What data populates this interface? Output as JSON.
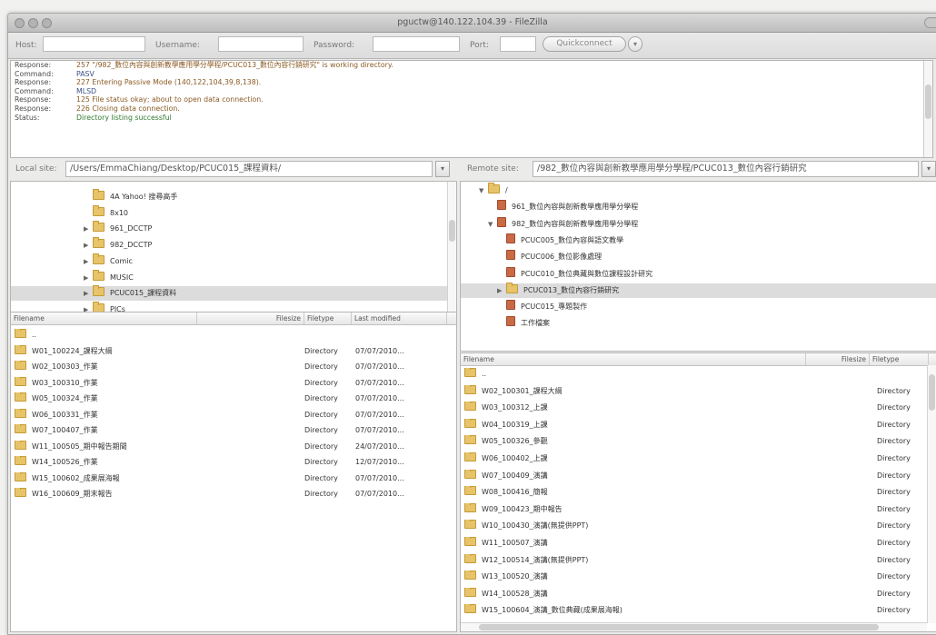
{
  "window": {
    "title": "pguctw@140.122.104.39 - FileZilla",
    "colors": {
      "folder": "#e7c469",
      "folder_special": "#c86b45",
      "selection": "#dcdcdc"
    }
  },
  "quickconnect": {
    "host_label": "Host:",
    "username_label": "Username:",
    "password_label": "Password:",
    "port_label": "Port:",
    "host_value": "",
    "username_value": "",
    "password_value": "",
    "port_value": "",
    "button_label": "Quickconnect",
    "dropdown_icon": "chevron-down-icon"
  },
  "log": [
    {
      "key": "Response:",
      "val": "257 \"/982_數位內容與創新教學應用學分學程/PCUC013_數位內容行銷研究\" is working directory.",
      "tone": "brown"
    },
    {
      "key": "Command:",
      "val": "PASV",
      "tone": "blue"
    },
    {
      "key": "Response:",
      "val": "227 Entering Passive Mode (140,122,104,39,8,138).",
      "tone": "brown"
    },
    {
      "key": "Command:",
      "val": "MLSD",
      "tone": "blue"
    },
    {
      "key": "Response:",
      "val": "125 File status okay; about to open data connection.",
      "tone": "brown"
    },
    {
      "key": "Response:",
      "val": "226 Closing data connection.",
      "tone": "brown"
    },
    {
      "key": "Status:",
      "val": "Directory listing successful",
      "tone": "green"
    }
  ],
  "local": {
    "site_label": "Local site:",
    "site_path": "/Users/EmmaChiang/Desktop/PCUC015_課程資料/",
    "tree": [
      {
        "expander": "",
        "label": "4A Yahoo! 搜尋高手",
        "indent": 1
      },
      {
        "expander": "",
        "label": "8x10",
        "indent": 1
      },
      {
        "expander": "▶",
        "label": "961_DCCTP",
        "indent": 1
      },
      {
        "expander": "▶",
        "label": "982_DCCTP",
        "indent": 1
      },
      {
        "expander": "▶",
        "label": "Comic",
        "indent": 1
      },
      {
        "expander": "▶",
        "label": "MUSIC",
        "indent": 1
      },
      {
        "expander": "▶",
        "label": "PCUC015_課程資料",
        "indent": 1,
        "selected": true
      },
      {
        "expander": "▶",
        "label": "PICs",
        "indent": 1
      }
    ],
    "columns": [
      "Filename",
      "Filesize",
      "Filetype",
      "Last modified"
    ],
    "files": [
      {
        "name": "..",
        "type": "",
        "modified": ""
      },
      {
        "name": "W01_100224_課程大綱",
        "type": "Directory",
        "modified": "07/07/2010..."
      },
      {
        "name": "W02_100303_作業",
        "type": "Directory",
        "modified": "07/07/2010..."
      },
      {
        "name": "W03_100310_作業",
        "type": "Directory",
        "modified": "07/07/2010..."
      },
      {
        "name": "W05_100324_作業",
        "type": "Directory",
        "modified": "07/07/2010..."
      },
      {
        "name": "W06_100331_作業",
        "type": "Directory",
        "modified": "07/07/2010..."
      },
      {
        "name": "W07_100407_作業",
        "type": "Directory",
        "modified": "07/07/2010..."
      },
      {
        "name": "W11_100505_期中報告期間",
        "type": "Directory",
        "modified": "24/07/2010..."
      },
      {
        "name": "W14_100526_作業",
        "type": "Directory",
        "modified": "12/07/2010..."
      },
      {
        "name": "W15_100602_成果展海報",
        "type": "Directory",
        "modified": "07/07/2010..."
      },
      {
        "name": "W16_100609_期末報告",
        "type": "Directory",
        "modified": "07/07/2010..."
      }
    ]
  },
  "remote": {
    "site_label": "Remote site:",
    "site_path": "/982_數位內容與創新教學應用學分學程/PCUC013_數位內容行銷研究",
    "tree": [
      {
        "expander": "▼",
        "label": "/",
        "indent": 0,
        "icon": "folder"
      },
      {
        "expander": "",
        "label": "961_數位內容與創新教學應用學分學程",
        "indent": 1,
        "icon": "red"
      },
      {
        "expander": "▼",
        "label": "982_數位內容與創新教學應用學分學程",
        "indent": 1,
        "icon": "red"
      },
      {
        "expander": "",
        "label": "PCUC005_數位內容與語文教學",
        "indent": 2,
        "icon": "red"
      },
      {
        "expander": "",
        "label": "PCUC006_數位影像處理",
        "indent": 2,
        "icon": "red"
      },
      {
        "expander": "",
        "label": "PCUC010_數位典藏與數位課程設計研究",
        "indent": 2,
        "icon": "red"
      },
      {
        "expander": "▶",
        "label": "PCUC013_數位內容行銷研究",
        "indent": 2,
        "icon": "folder",
        "selected": true
      },
      {
        "expander": "",
        "label": "PCUC015_專題製作",
        "indent": 2,
        "icon": "red"
      },
      {
        "expander": "",
        "label": "工作檔案",
        "indent": 2,
        "icon": "red"
      }
    ],
    "columns": [
      "Filename",
      "Filesize",
      "Filetype"
    ],
    "files": [
      {
        "name": "..",
        "type": ""
      },
      {
        "name": "W02_100301_課程大綱",
        "type": "Directory"
      },
      {
        "name": "W03_100312_上課",
        "type": "Directory"
      },
      {
        "name": "W04_100319_上課",
        "type": "Directory"
      },
      {
        "name": "W05_100326_參觀",
        "type": "Directory"
      },
      {
        "name": "W06_100402_上課",
        "type": "Directory"
      },
      {
        "name": "W07_100409_演講",
        "type": "Directory"
      },
      {
        "name": "W08_100416_簡報",
        "type": "Directory"
      },
      {
        "name": "W09_100423_期中報告",
        "type": "Directory"
      },
      {
        "name": "W10_100430_演講(無提供PPT)",
        "type": "Directory"
      },
      {
        "name": "W11_100507_演講",
        "type": "Directory"
      },
      {
        "name": "W12_100514_演講(無提供PPT)",
        "type": "Directory"
      },
      {
        "name": "W13_100520_演講",
        "type": "Directory"
      },
      {
        "name": "W14_100528_演講",
        "type": "Directory"
      },
      {
        "name": "W15_100604_演講_數位典藏(成果展海報)",
        "type": "Directory"
      }
    ]
  }
}
